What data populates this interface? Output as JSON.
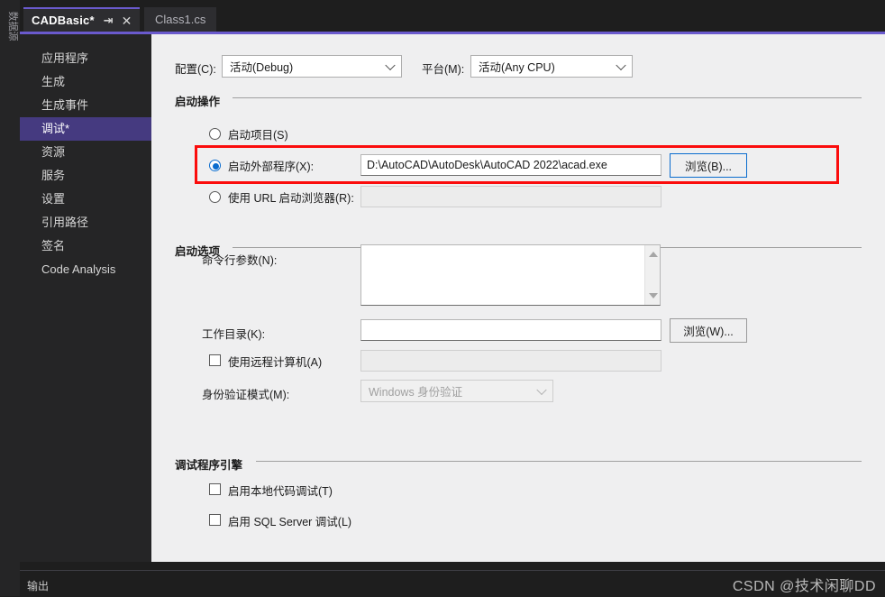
{
  "window": {
    "vertical_dock_label": "数据源"
  },
  "tabs": [
    {
      "label": "CADBasic*",
      "active": true,
      "pin_icon": "pin-icon",
      "close_icon": "close-icon"
    },
    {
      "label": "Class1.cs",
      "active": false
    }
  ],
  "nav": {
    "items": [
      {
        "label": "应用程序",
        "selected": false
      },
      {
        "label": "生成",
        "selected": false
      },
      {
        "label": "生成事件",
        "selected": false
      },
      {
        "label": "调试*",
        "selected": true
      },
      {
        "label": "资源",
        "selected": false
      },
      {
        "label": "服务",
        "selected": false
      },
      {
        "label": "设置",
        "selected": false
      },
      {
        "label": "引用路径",
        "selected": false
      },
      {
        "label": "签名",
        "selected": false
      },
      {
        "label": "Code Analysis",
        "selected": false
      }
    ]
  },
  "config_row": {
    "configuration_label": "配置(C):",
    "configuration_value": "活动(Debug)",
    "platform_label": "平台(M):",
    "platform_value": "活动(Any CPU)",
    "chevron_icon": "chevron-down-icon"
  },
  "start_action": {
    "group_title": "启动操作",
    "start_project": {
      "label": "启动项目(S)",
      "checked": false
    },
    "start_external_program": {
      "label": "启动外部程序(X):",
      "checked": true,
      "value": "D:\\AutoCAD\\AutoDesk\\AutoCAD 2022\\acad.exe",
      "browse_label": "浏览(B)..."
    },
    "start_browser_url": {
      "label": "使用 URL 启动浏览器(R):",
      "checked": false,
      "value": ""
    },
    "highlight_color": "#fb0c0c"
  },
  "start_options": {
    "group_title": "启动选项",
    "command_args_label": "命令行参数(N):",
    "command_args_value": "",
    "working_dir_label": "工作目录(K):",
    "working_dir_value": "",
    "working_dir_browse_label": "浏览(W)...",
    "remote_machine_label": "使用远程计算机(A)",
    "remote_machine_checked": false,
    "remote_machine_value": "",
    "auth_mode_label": "身份验证模式(M):",
    "auth_mode_value": "Windows 身份验证",
    "scroll_up_icon": "scroll-up-icon",
    "scroll_down_icon": "scroll-down-icon"
  },
  "debugger_engines": {
    "group_title": "调试程序引擎",
    "native_code": {
      "label": "启用本地代码调试(T)",
      "checked": false
    },
    "sql_server": {
      "label": "启用 SQL Server 调试(L)",
      "checked": false
    }
  },
  "output_panel": {
    "label": "输出",
    "watermark": "CSDN @技术闲聊DD"
  }
}
